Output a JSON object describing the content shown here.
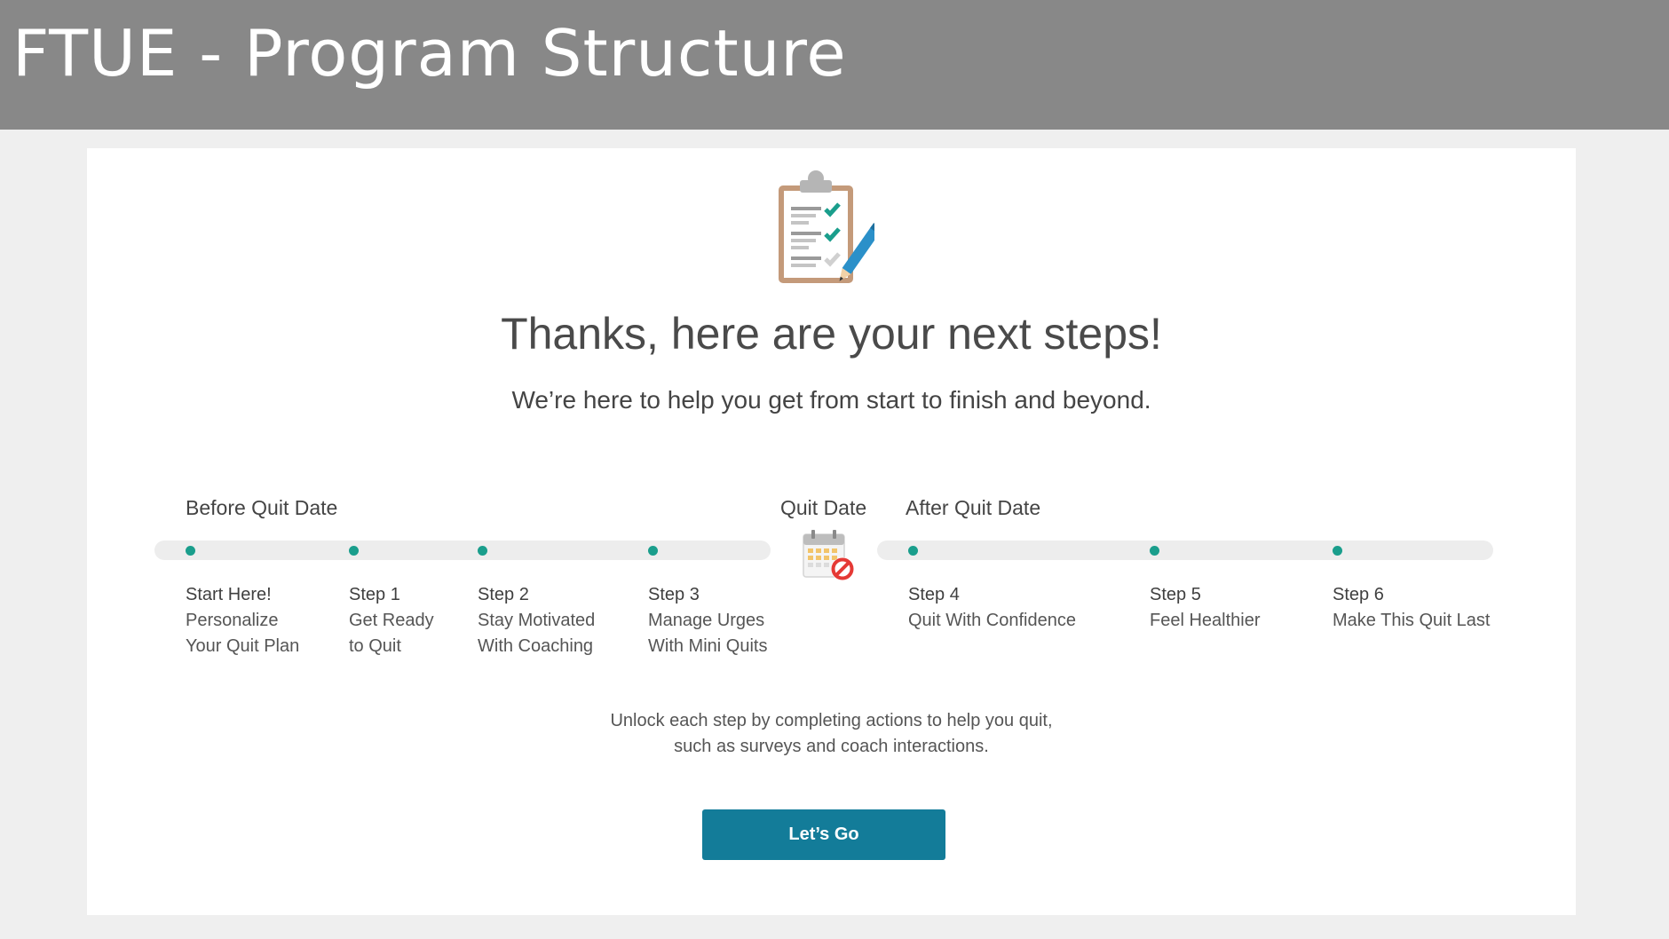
{
  "slide": {
    "title": "FTUE - Program Structure"
  },
  "main": {
    "heading": "Thanks, here are your next steps!",
    "subheading": "We’re here to help you get from start to finish and beyond.",
    "phases": {
      "before": "Before Quit Date",
      "quit": "Quit Date",
      "after": "After Quit Date"
    },
    "steps": [
      {
        "title": "Start Here!",
        "lines": [
          "Personalize",
          "Your Quit Plan"
        ]
      },
      {
        "title": "Step 1",
        "lines": [
          "Get Ready",
          "to Quit"
        ]
      },
      {
        "title": "Step 2",
        "lines": [
          "Stay Motivated",
          "With Coaching"
        ]
      },
      {
        "title": "Step 3",
        "lines": [
          "Manage Urges",
          "With Mini Quits"
        ]
      },
      {
        "title": "Step 4",
        "lines": [
          "Quit With Confidence"
        ]
      },
      {
        "title": "Step 5",
        "lines": [
          "Feel Healthier"
        ]
      },
      {
        "title": "Step 6",
        "lines": [
          "Make This Quit Last"
        ]
      }
    ],
    "note_lines": [
      "Unlock each step by completing actions to help you quit,",
      "such as surveys and coach interactions."
    ],
    "cta_label": "Let’s Go"
  },
  "icons": {
    "header_icon": "clipboard-checklist-icon",
    "quit_date_icon": "calendar-no-icon"
  },
  "colors": {
    "header_bg": "#888888",
    "accent_teal": "#1a9e8c",
    "button_bg": "#137c99",
    "track_bg": "#ededed"
  }
}
